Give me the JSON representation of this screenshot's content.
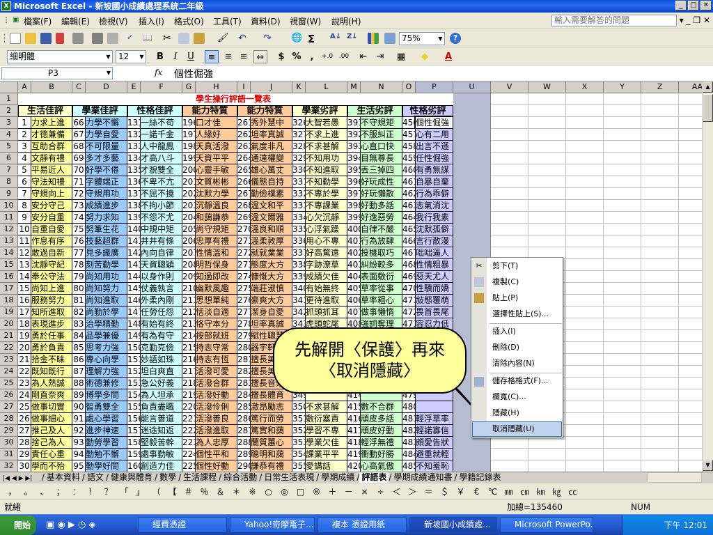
{
  "window": {
    "title": "Microsoft Excel - 新坡國小成績處理系統二年級"
  },
  "menu": {
    "items": [
      "檔案(F)",
      "編輯(E)",
      "檢視(V)",
      "插入(I)",
      "格式(O)",
      "工具(T)",
      "資料(D)",
      "視窗(W)",
      "說明(H)"
    ],
    "ask_placeholder": "輸入需要解答的問題"
  },
  "toolbar": {
    "zoom": "75%",
    "font": "細明體",
    "size": "12",
    "bold": "B",
    "italic": "I",
    "underline": "U",
    "currency": "$",
    "percent": "%",
    "comma": ","
  },
  "formula": {
    "namebox": "P3",
    "fx": "fx",
    "content": "個性倔強"
  },
  "sheet": {
    "title": "學生操行評語一覽表",
    "columns": [
      "A",
      "B",
      "C",
      "D",
      "E",
      "F",
      "G",
      "H",
      "I",
      "J",
      "K",
      "L",
      "M",
      "N",
      "O",
      "P",
      "U",
      "V",
      "W",
      "X",
      "Y",
      "Z",
      "AA"
    ],
    "group_headers": [
      "生活佳評",
      "學業佳評",
      "性格佳評",
      "能力特質",
      "能力特質",
      "學業劣評",
      "生活劣評",
      "性格劣評"
    ],
    "rows": [
      [
        "1",
        "力求上進",
        "66",
        "力學不懈",
        "131",
        "一絲不苟",
        "196",
        "口才佳",
        "261",
        "秀外慧中",
        "326",
        "大智若愚",
        "391",
        "不守規矩",
        "456",
        "個性倔強"
      ],
      [
        "2",
        "才德兼備",
        "67",
        "力學自愛",
        "132",
        "一諾千金",
        "197",
        "人緣好",
        "262",
        "坦率真誠",
        "327",
        "不求上進",
        "392",
        "不服糾正",
        "457",
        "心有二用"
      ],
      [
        "3",
        "互助合群",
        "68",
        "不可限量",
        "133",
        "人中龍鳳",
        "198",
        "天真活潑",
        "263",
        "氣度非凡",
        "328",
        "不求甚解",
        "393",
        "心直口快",
        "458",
        "出言不遜"
      ],
      [
        "4",
        "文靜有禮",
        "69",
        "多才多藝",
        "134",
        "才高八斗",
        "199",
        "天資平平",
        "264",
        "通達權變",
        "329",
        "不知用功",
        "394",
        "目無尊長",
        "459",
        "任性倔強"
      ],
      [
        "5",
        "平易近人",
        "70",
        "好學不倦",
        "135",
        "才貌雙全",
        "200",
        "心靈手敏",
        "265",
        "雄心萬丈",
        "330",
        "不知進取",
        "395",
        "丟三掉四",
        "460",
        "有勇無謀"
      ],
      [
        "6",
        "守法知禮",
        "71",
        "字體端正",
        "136",
        "不卑不亢",
        "201",
        "文質彬彬",
        "266",
        "儀態自持",
        "331",
        "不知勤學",
        "396",
        "好玩成性",
        "461",
        "自暴自棄"
      ],
      [
        "7",
        "守規向上",
        "72",
        "守規用功",
        "137",
        "不屈不撓",
        "202",
        "沈默力學",
        "267",
        "勤儉樸素",
        "332",
        "不專於學",
        "397",
        "好玩懶散",
        "462",
        "行為乖僻"
      ],
      [
        "8",
        "安分守己",
        "73",
        "成績進步",
        "138",
        "不拘小節",
        "203",
        "沉靜溫良",
        "268",
        "溫文和平",
        "333",
        "不專課業",
        "398",
        "好動多話",
        "463",
        "志氣消沈"
      ],
      [
        "9",
        "安分自重",
        "74",
        "努力求知",
        "139",
        "不怨不尤",
        "204",
        "和藹謙恭",
        "269",
        "溫文爾雅",
        "334",
        "心欠沉靜",
        "399",
        "好逸惡勞",
        "464",
        "我行我素"
      ],
      [
        "10",
        "自重自愛",
        "75",
        "努筆生花",
        "140",
        "中規中矩",
        "205",
        "尚守規矩",
        "270",
        "溫良和順",
        "335",
        "心浮氣躁",
        "400",
        "自律不嚴",
        "465",
        "沈默孤僻"
      ],
      [
        "11",
        "作息有序",
        "76",
        "技藝超群",
        "141",
        "井井有條",
        "206",
        "忠厚有禮",
        "271",
        "溫柔敦厚",
        "336",
        "用心不專",
        "401",
        "行為放肆",
        "466",
        "言行散漫"
      ],
      [
        "12",
        "敢過自新",
        "77",
        "見多識廣",
        "142",
        "內向自律",
        "207",
        "性情溫和",
        "272",
        "就就業業",
        "337",
        "好高騖遠",
        "402",
        "投機取巧",
        "467",
        "咄咄逼人"
      ],
      [
        "13",
        "沈靜守紀",
        "78",
        "刻苦勤學",
        "143",
        "天資聰穎",
        "208",
        "明哲保身",
        "273",
        "態度大方",
        "338",
        "字跡潦草",
        "403",
        "糾紛較多",
        "468",
        "性情粗暴"
      ],
      [
        "14",
        "奉公守法",
        "79",
        "尚知用功",
        "144",
        "以身作則",
        "209",
        "知過即改",
        "274",
        "慷慨大方",
        "339",
        "成績欠佳",
        "404",
        "表面敷衍",
        "469",
        "惡天尤人"
      ],
      [
        "15",
        "尚知上進",
        "80",
        "尚知努力",
        "145",
        "仗義執言",
        "210",
        "幽默風趣",
        "275",
        "端莊淑慎",
        "340",
        "有始無終",
        "405",
        "草率從事",
        "470",
        "性驕而嬌"
      ],
      [
        "16",
        "服務努力",
        "81",
        "尚知進取",
        "146",
        "外柔內剛",
        "211",
        "思想單純",
        "276",
        "豪爽大方",
        "341",
        "更待進取",
        "406",
        "草率粗心",
        "471",
        "敍態覆萌"
      ],
      [
        "17",
        "知所進取",
        "82",
        "尚勤於學",
        "147",
        "任勞任怨",
        "212",
        "恬淡自適",
        "277",
        "潔身自愛",
        "342",
        "抓頭抓耳",
        "407",
        "做事懶惰",
        "472",
        "畏首畏尾"
      ],
      [
        "18",
        "表現進步",
        "83",
        "治學精勤",
        "148",
        "有始有終",
        "213",
        "恪守本分",
        "278",
        "坦率真誠",
        "343",
        "虎頭蛇尾",
        "408",
        "強詞奪理",
        "473",
        "容忍力低"
      ],
      [
        "19",
        "勇於任事",
        "84",
        "品學兼優",
        "149",
        "有為有守",
        "214",
        "按部就班",
        "279",
        "賦性聰慧",
        "344",
        "",
        "409",
        "",
        "474",
        ""
      ],
      [
        "20",
        "勇於負責",
        "85",
        "思考力強",
        "150",
        "克勤克儉",
        "215",
        "持志守常",
        "280",
        "器宇軒昂",
        "345",
        "",
        "410",
        "",
        "475",
        ""
      ],
      [
        "21",
        "拾金不昧",
        "86",
        "專心向學",
        "151",
        "妙語如珠",
        "216",
        "持志有恆",
        "281",
        "擅長美術",
        "346",
        "",
        "411",
        "",
        "476",
        ""
      ],
      [
        "22",
        "既知既行",
        "87",
        "理解力強",
        "152",
        "坦白爽直",
        "217",
        "活潑可愛",
        "282",
        "擅長美勞",
        "347",
        "",
        "412",
        "",
        "477",
        ""
      ],
      [
        "23",
        "為人熱誠",
        "88",
        "術德兼修",
        "153",
        "急公好義",
        "218",
        "活潑合群",
        "283",
        "擅長音樂",
        "348",
        "",
        "413",
        "",
        "478",
        ""
      ],
      [
        "24",
        "剛直奈爽",
        "89",
        "博學多問",
        "154",
        "為人坦承",
        "219",
        "活潑好動",
        "284",
        "擅長體育",
        "349",
        "",
        "414",
        "",
        "479",
        ""
      ],
      [
        "25",
        "做事切實",
        "90",
        "智勇雙全",
        "155",
        "負責盡職",
        "220",
        "活潑伶俐",
        "285",
        "激昂勵志",
        "350",
        "不求甚解",
        "415",
        "數不合群",
        "480",
        ""
      ],
      [
        "26",
        "做事細心",
        "91",
        "處心學習",
        "156",
        "能言善道",
        "221",
        "活潑善良",
        "286",
        "篤行而勞",
        "351",
        "敷衍塞責",
        "416",
        "頑皮多話",
        "481",
        "輕浮草率"
      ],
      [
        "27",
        "推己及人",
        "92",
        "進步神速",
        "157",
        "迷途知返",
        "222",
        "活潑進取",
        "287",
        "篤實和藹",
        "352",
        "學習不專",
        "417",
        "頑皮好動",
        "482",
        "輕諾寡信"
      ],
      [
        "28",
        "捨己為人",
        "93",
        "勤勞學習",
        "158",
        "堅毅苦幹",
        "223",
        "為人忠厚",
        "288",
        "蘭質蕙心",
        "353",
        "學業欠佳",
        "418",
        "輕浮無禮",
        "483",
        "頗愛告狀"
      ],
      [
        "29",
        "責任心重",
        "94",
        "勤勉不懈",
        "159",
        "處事勤敏",
        "224",
        "個性平和",
        "289",
        "聰明和藹",
        "354",
        "課業平平",
        "419",
        "衝動好勝",
        "484",
        "避重就輕"
      ],
      [
        "30",
        "學而不殆",
        "95",
        "勤學好問",
        "160",
        "創造力佳",
        "225",
        "個性好動",
        "290",
        "謙恭有禮",
        "355",
        "愛講話",
        "420",
        "心高氣傲",
        "485",
        "不知羞恥"
      ]
    ]
  },
  "callout": {
    "line1": "先解開〈保護〉再來",
    "line2": "〈取消隱藏〉"
  },
  "context_menu": {
    "items": [
      "剪下(T)",
      "複製(C)",
      "貼上(P)",
      "選擇性貼上(S)...",
      "插入(I)",
      "刪除(D)",
      "清除內容(N)",
      "儲存格格式(F)...",
      "欄寬(C)...",
      "隱藏(H)",
      "取消隱藏(U)"
    ]
  },
  "sheet_tabs": [
    "基本資料",
    "語文",
    "健康與體育",
    "數學",
    "生活課程",
    "綜合活動",
    "日常生活表現",
    "學期成績",
    "評語表",
    "學期成績通知書",
    "學籍記錄表"
  ],
  "active_tab": "評語表",
  "symbols": [
    "，",
    "。",
    "、",
    "；",
    "：",
    "！",
    "？",
    "「",
    "」",
    "（",
    "【",
    "＃",
    "％",
    "＆",
    "＊",
    "※",
    "○",
    "◎",
    "□",
    "®",
    "＋",
    "－",
    "×",
    "÷",
    "＜",
    "＞",
    "＝",
    "＄",
    "￥",
    "€",
    "℃",
    "㎜",
    "㎝",
    "㎞",
    "㎏",
    "㏄"
  ],
  "status": {
    "ready": "就緒",
    "sum": "加總=135460",
    "num": "NUM"
  },
  "taskbar": {
    "start": "開始",
    "tasks": [
      "經費憑證",
      "Yahoo!奇摩電子...",
      "複本 憑證用紙",
      "新坡國小成績處...",
      "Microsoft PowerPo..."
    ],
    "clock": "下午 12:01"
  }
}
